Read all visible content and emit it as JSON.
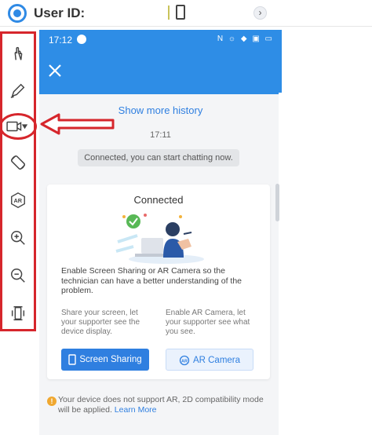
{
  "header": {
    "user_id_label": "User ID:"
  },
  "toolbar": {
    "tools": [
      {
        "icon": "hand-pointer-icon"
      },
      {
        "icon": "pen-icon"
      },
      {
        "icon": "video-camera-icon"
      },
      {
        "icon": "rotate-icon"
      },
      {
        "icon": "ar-icon"
      },
      {
        "icon": "zoom-in-icon"
      },
      {
        "icon": "zoom-out-icon"
      },
      {
        "icon": "vibrate-icon"
      }
    ]
  },
  "phone": {
    "status_time": "17:12",
    "status_icons": "N ☼ ◆ ▣ ▭",
    "chat": {
      "show_more_history": "Show more history",
      "timestamp": "17:11",
      "connected_message": "Connected, you can start chatting now."
    },
    "card": {
      "title": "Connected",
      "description": "Enable Screen Sharing or AR Camera so the technician can have a better understanding of the problem.",
      "left_desc": "Share your screen, let your supporter see the device display.",
      "right_desc": "Enable AR Camera, let your supporter see what you see.",
      "screen_sharing_label": "Screen Sharing",
      "ar_camera_label": "AR Camera"
    },
    "notice": {
      "text": "Your device does not support AR, 2D compatibility mode will be applied. ",
      "link": "Learn More"
    }
  },
  "colors": {
    "accent": "#2e8de6",
    "highlight_red": "#d6262c",
    "warning": "#f0a830"
  }
}
